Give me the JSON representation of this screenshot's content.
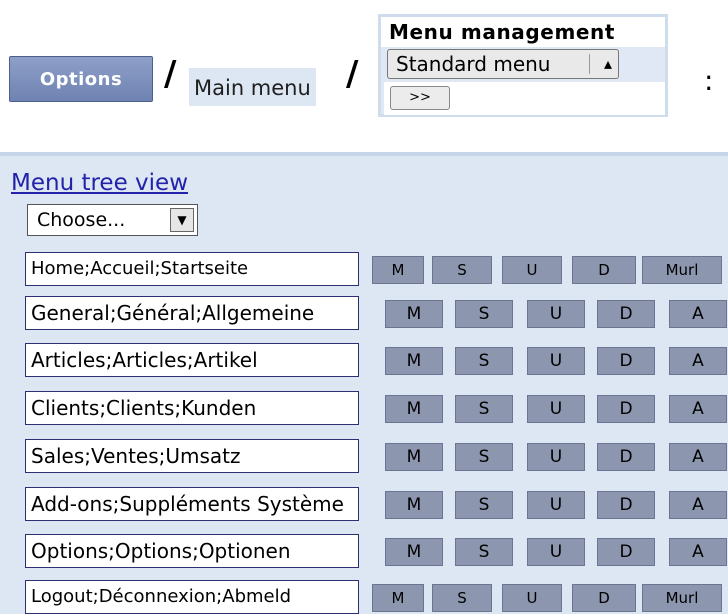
{
  "header": {
    "options_button": "Options",
    "separator": "/",
    "breadcrumb": "Main menu",
    "trailing": ":"
  },
  "menu_management": {
    "title": "Menu management",
    "select_value": "Standard menu",
    "go_button": ">>"
  },
  "tree": {
    "link": "Menu tree view",
    "choose": "Choose...",
    "rows": [
      {
        "name": "Home;Accueil;Startseite",
        "actions": [
          "M",
          "S",
          "U",
          "D",
          "Murl"
        ]
      },
      {
        "name": "General;Général;Allgemeine",
        "actions": [
          "M",
          "S",
          "U",
          "D",
          "A"
        ]
      },
      {
        "name": "Articles;Articles;Artikel",
        "actions": [
          "M",
          "S",
          "U",
          "D",
          "A"
        ]
      },
      {
        "name": "Clients;Clients;Kunden",
        "actions": [
          "M",
          "S",
          "U",
          "D",
          "A"
        ]
      },
      {
        "name": "Sales;Ventes;Umsatz",
        "actions": [
          "M",
          "S",
          "U",
          "D",
          "A"
        ]
      },
      {
        "name": "Add-ons;Suppléments Système",
        "actions": [
          "M",
          "S",
          "U",
          "D",
          "A"
        ]
      },
      {
        "name": "Options;Options;Optionen",
        "actions": [
          "M",
          "S",
          "U",
          "D",
          "A"
        ]
      },
      {
        "name": "Logout;Déconnexion;Abmeld",
        "actions": [
          "M",
          "S",
          "U",
          "D",
          "Murl"
        ]
      }
    ]
  }
}
